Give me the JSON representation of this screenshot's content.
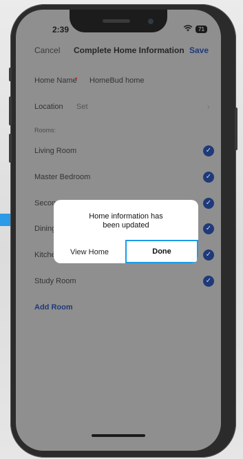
{
  "status": {
    "time": "2:39",
    "battery": "71",
    "wifi_icon": "wifi-icon"
  },
  "nav": {
    "cancel": "Cancel",
    "title": "Complete Home Information",
    "save": "Save"
  },
  "home_name": {
    "label": "Home Name",
    "required_mark": "•",
    "value": "HomeBud home"
  },
  "location": {
    "label": "Location",
    "value": "Set"
  },
  "rooms": {
    "caption": "Rooms:",
    "items": [
      {
        "label": "Living Room"
      },
      {
        "label": "Master Bedroom"
      },
      {
        "label": "Second Bedroom"
      },
      {
        "label": "Dining Room"
      },
      {
        "label": "Kitchen"
      },
      {
        "label": "Study Room"
      }
    ],
    "add_label": "Add Room"
  },
  "dialog": {
    "message_line1": "Home information has",
    "message_line2": "been updated",
    "view_home": "View Home",
    "done": "Done"
  },
  "colors": {
    "accent": "#1f3a7a",
    "focus_outline": "#1a9be8"
  }
}
